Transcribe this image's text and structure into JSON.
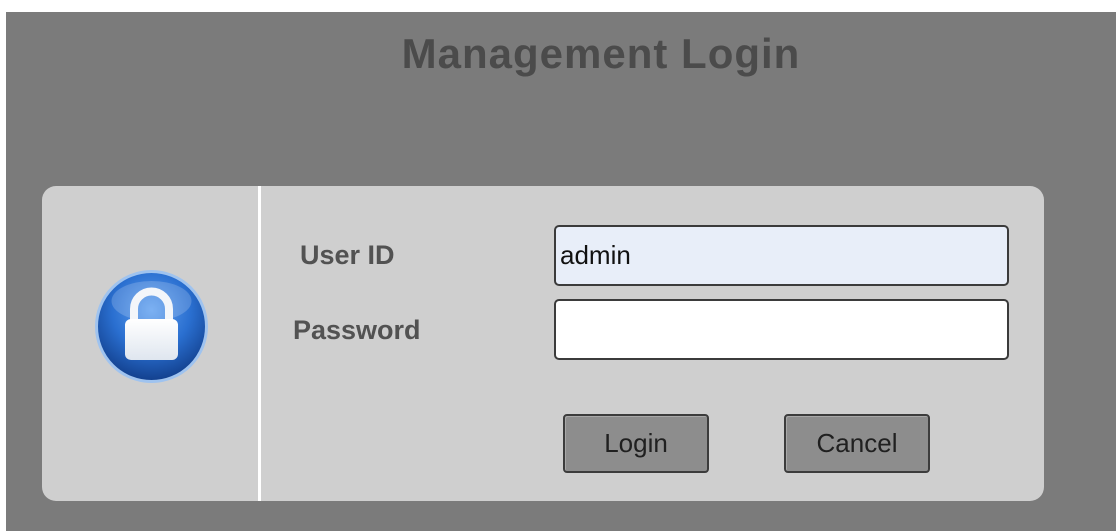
{
  "page": {
    "title": "Management Login"
  },
  "form": {
    "user_id": {
      "label": "User ID",
      "value": "admin"
    },
    "password": {
      "label": "Password",
      "value": ""
    },
    "buttons": {
      "login_label": "Login",
      "cancel_label": "Cancel"
    }
  },
  "icons": {
    "lock": "lock-icon"
  },
  "colors": {
    "background": "#7b7b7b",
    "panel": "#cfcfcf",
    "title": "#4b4b4b",
    "label": "#525252",
    "button": "#8d8d8d",
    "lock_blue": "#1f63c4",
    "user_field_fill": "#e8eef9"
  }
}
